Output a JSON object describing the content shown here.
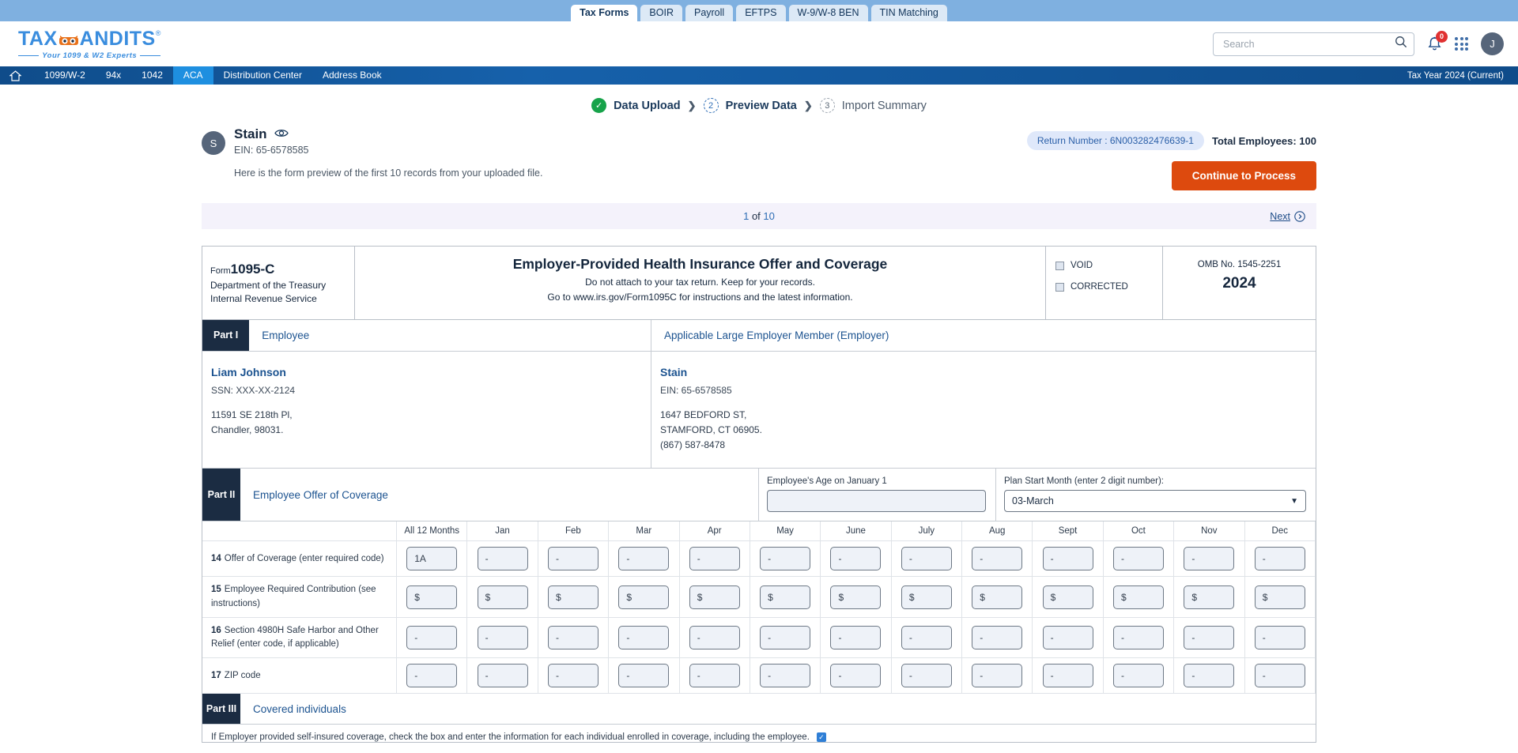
{
  "product_tabs": [
    {
      "label": "Tax Forms",
      "active": true
    },
    {
      "label": "BOIR",
      "active": false
    },
    {
      "label": "Payroll",
      "active": false
    },
    {
      "label": "EFTPS",
      "active": false
    },
    {
      "label": "W-9/W-8 BEN",
      "active": false
    },
    {
      "label": "TIN Matching",
      "active": false
    }
  ],
  "header": {
    "logo_text_a": "TAX",
    "logo_text_b": "ANDITS",
    "logo_tm": "®",
    "logo_tagline": "Your 1099 & W2 Experts",
    "search_placeholder": "Search",
    "search_value": "",
    "notification_count": "0",
    "avatar_initial": "J"
  },
  "nav": {
    "items": [
      {
        "label": "1099/W-2",
        "active": false
      },
      {
        "label": "94x",
        "active": false
      },
      {
        "label": "1042",
        "active": false
      },
      {
        "label": "ACA",
        "active": true
      },
      {
        "label": "Distribution Center",
        "active": false
      },
      {
        "label": "Address Book",
        "active": false
      }
    ],
    "tax_year": "Tax Year 2024 (Current)"
  },
  "stepper": {
    "steps": [
      {
        "marker": "✓",
        "label": "Data Upload",
        "state": "done"
      },
      {
        "marker": "2",
        "label": "Preview Data",
        "state": "current"
      },
      {
        "marker": "3",
        "label": "Import Summary",
        "state": "pending"
      }
    ],
    "separator": "❯"
  },
  "company": {
    "avatar_initial": "S",
    "name": "Stain",
    "ein": "EIN: 65-6578585",
    "note": "Here is the form preview of the first 10 records from your uploaded file.",
    "return_number": "Return Number :  6N003282476639-1",
    "total_employees_label": "Total Employees:",
    "total_employees_value": "100",
    "continue_label": "Continue to Process"
  },
  "pager": {
    "current": "1",
    "of": "of",
    "total": "10",
    "next_label": "Next"
  },
  "form": {
    "form_word": "Form",
    "form_number": "1095-C",
    "dept_line1": "Department of the Treasury",
    "dept_line2": "Internal Revenue Service",
    "title": "Employer-Provided Health Insurance Offer and Coverage",
    "sub1": "Do not attach to your tax return. Keep for your records.",
    "sub2": "Go to www.irs.gov/Form1095C for instructions and the latest information.",
    "void_label": "VOID",
    "corrected_label": "CORRECTED",
    "omb": "OMB No. 1545-2251",
    "year": "2024",
    "part1": {
      "tag": "Part I",
      "employee_label": "Employee",
      "employer_label": "Applicable Large Employer Member (Employer)",
      "employee": {
        "name": "Liam Johnson",
        "ssn": "SSN: XXX-XX-2124",
        "addr1": "11591 SE 218th Pl,",
        "addr2": "Chandler, 98031."
      },
      "employer": {
        "name": "Stain",
        "ein": "EIN: 65-6578585",
        "addr1": "1647 BEDFORD ST,",
        "addr2": "STAMFORD, CT 06905.",
        "phone": "(867) 587-8478"
      }
    },
    "part2": {
      "tag": "Part II",
      "label": "Employee Offer of Coverage",
      "age_label": "Employee's Age on January 1",
      "age_value": "",
      "plan_label": "Plan Start Month (enter 2 digit number):",
      "plan_value": "03-March"
    },
    "columns": [
      "All 12 Months",
      "Jan",
      "Feb",
      "Mar",
      "Apr",
      "May",
      "June",
      "July",
      "Aug",
      "Sept",
      "Oct",
      "Nov",
      "Dec"
    ],
    "rows": [
      {
        "num": "14",
        "label": "Offer of Coverage (enter required code)",
        "values": [
          "1A",
          "-",
          "-",
          "-",
          "-",
          "-",
          "-",
          "-",
          "-",
          "-",
          "-",
          "-",
          "-"
        ]
      },
      {
        "num": "15",
        "label": "Employee Required Contribution (see instructions)",
        "values": [
          "$",
          "$",
          "$",
          "$",
          "$",
          "$",
          "$",
          "$",
          "$",
          "$",
          "$",
          "$",
          "$"
        ]
      },
      {
        "num": "16",
        "label": "Section 4980H Safe Harbor and Other Relief (enter code, if applicable)",
        "values": [
          "-",
          "-",
          "-",
          "-",
          "-",
          "-",
          "-",
          "-",
          "-",
          "-",
          "-",
          "-",
          "-"
        ]
      },
      {
        "num": "17",
        "label": "ZIP code",
        "values": [
          "-",
          "-",
          "-",
          "-",
          "-",
          "-",
          "-",
          "-",
          "-",
          "-",
          "-",
          "-",
          "-"
        ]
      }
    ],
    "part3": {
      "tag": "Part III",
      "label": "Covered individuals",
      "note": "If Employer provided self-insured coverage, check the box and enter the information for each individual enrolled in coverage, including the employee.",
      "checked": "✓"
    }
  },
  "colors": {
    "brand_blue": "#3a8dde",
    "nav_blue": "#0f4c8a",
    "nav_active": "#1e8fe0",
    "accent_orange": "#dd4a0e",
    "step_done_green": "#17a34a",
    "dark_navy": "#1b2c42"
  }
}
